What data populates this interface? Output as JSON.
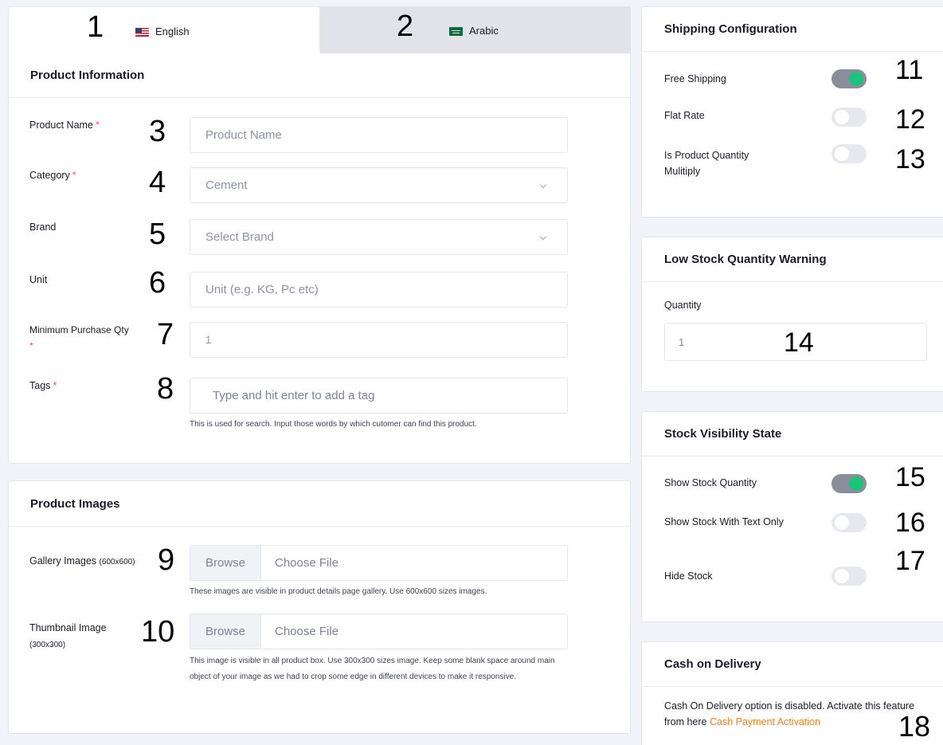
{
  "tabs": [
    {
      "num": "1",
      "label": "English",
      "flag": "us-flag",
      "active": true
    },
    {
      "num": "2",
      "label": "Arabic",
      "flag": "sa-flag",
      "active": false
    }
  ],
  "product_info": {
    "title": "Product Information",
    "fields": {
      "name": {
        "num": "3",
        "label": "Product Name",
        "required": "*",
        "placeholder": "Product Name"
      },
      "category": {
        "num": "4",
        "label": "Category",
        "required": "*",
        "value": "Cement"
      },
      "brand": {
        "num": "5",
        "label": "Brand",
        "placeholder": "Select Brand"
      },
      "unit": {
        "num": "6",
        "label": "Unit",
        "placeholder": "Unit (e.g. KG, Pc etc)"
      },
      "min_qty": {
        "num": "7",
        "label": "Minimum Purchase Qty",
        "required": "*",
        "value": "1"
      },
      "tags": {
        "num": "8",
        "label": "Tags",
        "required": "*",
        "placeholder": "Type and hit enter to add a tag",
        "hint": "This is used for search. Input those words by which cutomer can find this product."
      }
    }
  },
  "product_images": {
    "title": "Product Images",
    "gallery": {
      "num": "9",
      "label": "Gallery Images",
      "size": "(600x600)",
      "browse": "Browse",
      "choose": "Choose File",
      "hint": "These images are visible in product details page gallery. Use 600x600 sizes images."
    },
    "thumbnail": {
      "num": "10",
      "label": "Thumbnail Image",
      "size": "(300x300)",
      "browse": "Browse",
      "choose": "Choose File",
      "hint": "This image is visible in all product box. Use 300x300 sizes image. Keep some blank space around main object of your image as we had to crop some edge in different devices to make it responsive."
    }
  },
  "shipping": {
    "title": "Shipping Configuration",
    "items": [
      {
        "num": "11",
        "label": "Free Shipping",
        "on": true
      },
      {
        "num": "12",
        "label": "Flat Rate",
        "on": false
      },
      {
        "num": "13",
        "label": "Is Product Quantity Mulitiply",
        "on": false
      }
    ]
  },
  "low_stock": {
    "title": "Low Stock Quantity Warning",
    "label": "Quantity",
    "value": "1",
    "num": "14"
  },
  "stock_visibility": {
    "title": "Stock Visibility State",
    "items": [
      {
        "num": "15",
        "label": "Show Stock Quantity",
        "on": true
      },
      {
        "num": "16",
        "label": "Show Stock With Text Only",
        "on": false
      },
      {
        "num": "17",
        "label": "Hide Stock",
        "on": false
      }
    ]
  },
  "cod": {
    "title": "Cash on Delivery",
    "text": "Cash On Delivery option is disabled. Activate this feature from here",
    "link": "Cash Payment Activation",
    "num": "18"
  },
  "colors": {
    "accent_on": "#1bc47d",
    "required": "#f64e60",
    "link": "#fd7e14"
  }
}
